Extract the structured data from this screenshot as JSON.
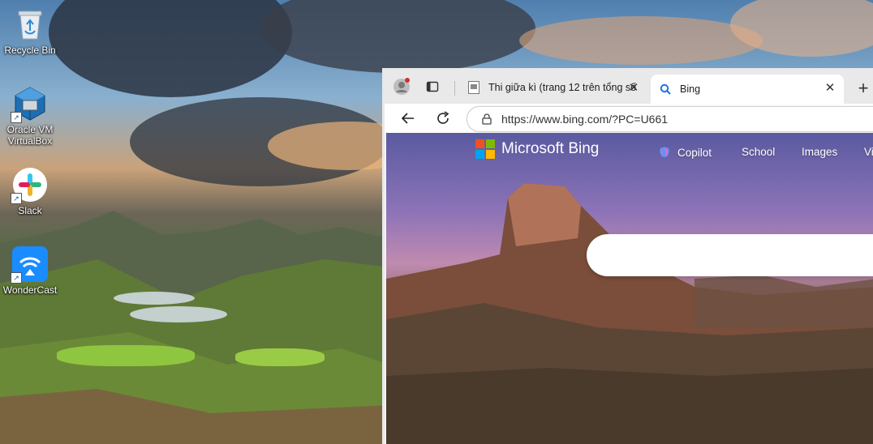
{
  "desktop": {
    "icons": [
      {
        "label": "Recycle Bin",
        "icon": "recycle-bin-icon"
      },
      {
        "label": "Oracle VM\nVirtualBox",
        "icon": "virtualbox-icon"
      },
      {
        "label": "Slack",
        "icon": "slack-icon"
      },
      {
        "label": "WonderCast",
        "icon": "wondercast-icon"
      }
    ]
  },
  "browser": {
    "tabs": [
      {
        "title": "Thi giữa kì (trang 12 trên tổng số",
        "favicon": "document-icon",
        "active": false
      },
      {
        "title": "Bing",
        "favicon": "search-icon",
        "active": true
      }
    ],
    "address": {
      "url": "https://www.bing.com/?PC=U661"
    }
  },
  "bing": {
    "logo_text": "Microsoft Bing",
    "nav": [
      {
        "label": "Copilot"
      },
      {
        "label": "School"
      },
      {
        "label": "Images"
      },
      {
        "label": "Vi"
      }
    ]
  },
  "colors": {
    "ms_red": "#f25022",
    "ms_green": "#7fba00",
    "ms_blue": "#00a4ef",
    "ms_yellow": "#ffb900",
    "tab_strip": "#e9e9e9"
  }
}
